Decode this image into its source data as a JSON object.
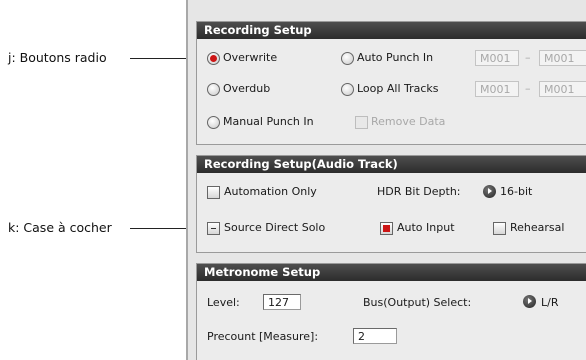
{
  "callouts": {
    "radio": "j: Boutons radio",
    "checkbox": "k: Case à cocher"
  },
  "recording_setup": {
    "title": "Recording Setup",
    "overwrite": "Overwrite",
    "auto_punch_in": "Auto Punch In",
    "auto_punch_from": "M001",
    "auto_punch_to": "M001",
    "overdub": "Overdub",
    "loop_all_tracks": "Loop All Tracks",
    "loop_from": "M001",
    "loop_to": "M001",
    "range_sep": "–",
    "manual_punch_in": "Manual Punch In",
    "remove_data": "Remove Data",
    "selected_mode": "Overwrite"
  },
  "audio_setup": {
    "title": "Recording Setup(Audio Track)",
    "automation_only": "Automation Only",
    "hdr_bit_depth_label": "HDR Bit Depth:",
    "hdr_bit_depth_value": "16-bit",
    "source_direct_solo": "Source Direct Solo",
    "auto_input": "Auto Input",
    "rehearsal": "Rehearsal",
    "automation_only_checked": false,
    "source_direct_solo_checked": false,
    "auto_input_checked": true,
    "rehearsal_checked": false
  },
  "metronome": {
    "title": "Metronome Setup",
    "level_label": "Level:",
    "level_value": "127",
    "bus_label": "Bus(Output) Select:",
    "bus_value": "L/R",
    "precount_label": "Precount [Measure]:",
    "precount_value": "2"
  },
  "colors": {
    "header_bg": "#3a3a3a",
    "panel_bg": "#e6e6e6",
    "selected_red": "#cc1515"
  }
}
